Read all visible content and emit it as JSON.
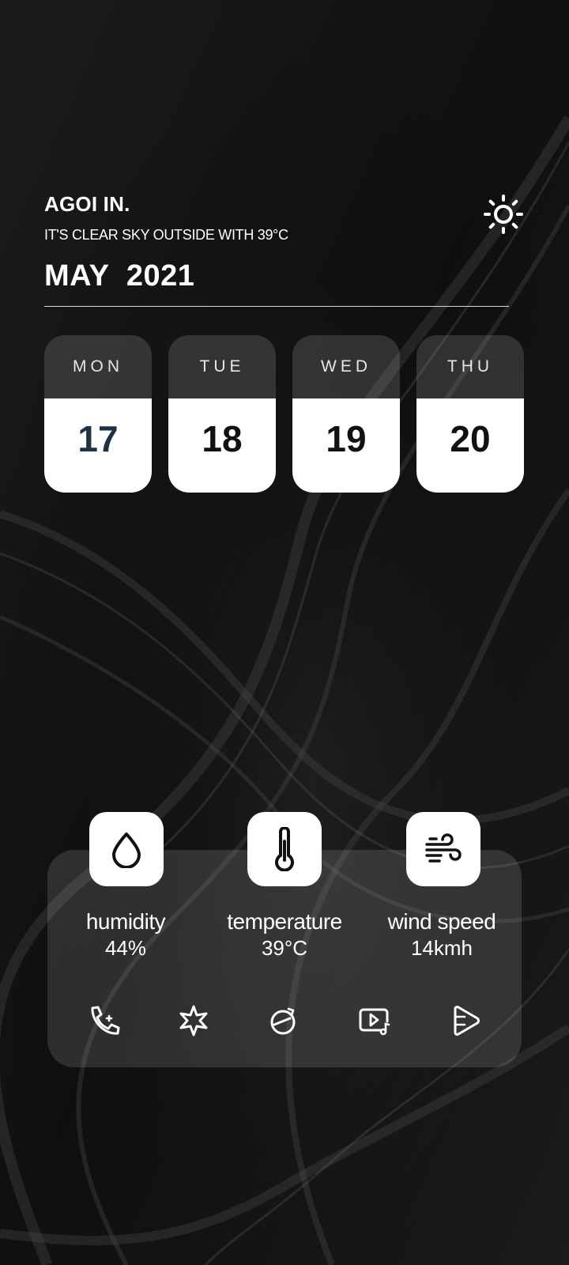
{
  "header": {
    "title": "AGOI IN.",
    "subtitle": "IT'S CLEAR SKY OUTSIDE WITH 39°C",
    "date": "MAY  2021",
    "weather_icon": "sun-icon"
  },
  "days": [
    {
      "name": "MON",
      "number": "17"
    },
    {
      "name": "TUE",
      "number": "18"
    },
    {
      "name": "WED",
      "number": "19"
    },
    {
      "name": "THU",
      "number": "20"
    }
  ],
  "stats": [
    {
      "icon": "droplet-icon",
      "label": "humidity",
      "value": "44%"
    },
    {
      "icon": "thermometer-icon",
      "label": "temperature",
      "value": "39°C"
    },
    {
      "icon": "wind-icon",
      "label": "wind speed",
      "value": "14kmh"
    }
  ],
  "dock": [
    {
      "icon": "phone-icon"
    },
    {
      "icon": "flower-icon"
    },
    {
      "icon": "compass-icon"
    },
    {
      "icon": "video-music-icon"
    },
    {
      "icon": "play-store-icon"
    }
  ],
  "colors": {
    "background": "#141414",
    "card_white": "#ffffff",
    "today_number": "#1e3246"
  }
}
